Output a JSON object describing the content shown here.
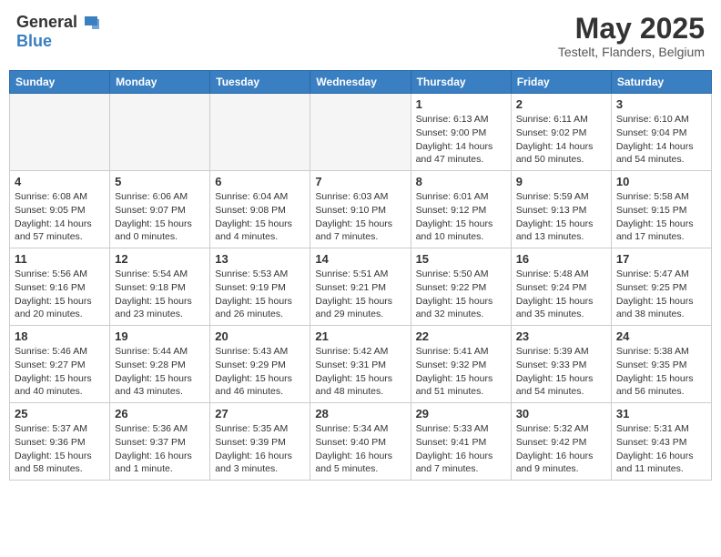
{
  "header": {
    "logo_general": "General",
    "logo_blue": "Blue",
    "title": "May 2025",
    "location": "Testelt, Flanders, Belgium"
  },
  "weekdays": [
    "Sunday",
    "Monday",
    "Tuesday",
    "Wednesday",
    "Thursday",
    "Friday",
    "Saturday"
  ],
  "weeks": [
    [
      {
        "day": "",
        "info": ""
      },
      {
        "day": "",
        "info": ""
      },
      {
        "day": "",
        "info": ""
      },
      {
        "day": "",
        "info": ""
      },
      {
        "day": "1",
        "info": "Sunrise: 6:13 AM\nSunset: 9:00 PM\nDaylight: 14 hours\nand 47 minutes."
      },
      {
        "day": "2",
        "info": "Sunrise: 6:11 AM\nSunset: 9:02 PM\nDaylight: 14 hours\nand 50 minutes."
      },
      {
        "day": "3",
        "info": "Sunrise: 6:10 AM\nSunset: 9:04 PM\nDaylight: 14 hours\nand 54 minutes."
      }
    ],
    [
      {
        "day": "4",
        "info": "Sunrise: 6:08 AM\nSunset: 9:05 PM\nDaylight: 14 hours\nand 57 minutes."
      },
      {
        "day": "5",
        "info": "Sunrise: 6:06 AM\nSunset: 9:07 PM\nDaylight: 15 hours\nand 0 minutes."
      },
      {
        "day": "6",
        "info": "Sunrise: 6:04 AM\nSunset: 9:08 PM\nDaylight: 15 hours\nand 4 minutes."
      },
      {
        "day": "7",
        "info": "Sunrise: 6:03 AM\nSunset: 9:10 PM\nDaylight: 15 hours\nand 7 minutes."
      },
      {
        "day": "8",
        "info": "Sunrise: 6:01 AM\nSunset: 9:12 PM\nDaylight: 15 hours\nand 10 minutes."
      },
      {
        "day": "9",
        "info": "Sunrise: 5:59 AM\nSunset: 9:13 PM\nDaylight: 15 hours\nand 13 minutes."
      },
      {
        "day": "10",
        "info": "Sunrise: 5:58 AM\nSunset: 9:15 PM\nDaylight: 15 hours\nand 17 minutes."
      }
    ],
    [
      {
        "day": "11",
        "info": "Sunrise: 5:56 AM\nSunset: 9:16 PM\nDaylight: 15 hours\nand 20 minutes."
      },
      {
        "day": "12",
        "info": "Sunrise: 5:54 AM\nSunset: 9:18 PM\nDaylight: 15 hours\nand 23 minutes."
      },
      {
        "day": "13",
        "info": "Sunrise: 5:53 AM\nSunset: 9:19 PM\nDaylight: 15 hours\nand 26 minutes."
      },
      {
        "day": "14",
        "info": "Sunrise: 5:51 AM\nSunset: 9:21 PM\nDaylight: 15 hours\nand 29 minutes."
      },
      {
        "day": "15",
        "info": "Sunrise: 5:50 AM\nSunset: 9:22 PM\nDaylight: 15 hours\nand 32 minutes."
      },
      {
        "day": "16",
        "info": "Sunrise: 5:48 AM\nSunset: 9:24 PM\nDaylight: 15 hours\nand 35 minutes."
      },
      {
        "day": "17",
        "info": "Sunrise: 5:47 AM\nSunset: 9:25 PM\nDaylight: 15 hours\nand 38 minutes."
      }
    ],
    [
      {
        "day": "18",
        "info": "Sunrise: 5:46 AM\nSunset: 9:27 PM\nDaylight: 15 hours\nand 40 minutes."
      },
      {
        "day": "19",
        "info": "Sunrise: 5:44 AM\nSunset: 9:28 PM\nDaylight: 15 hours\nand 43 minutes."
      },
      {
        "day": "20",
        "info": "Sunrise: 5:43 AM\nSunset: 9:29 PM\nDaylight: 15 hours\nand 46 minutes."
      },
      {
        "day": "21",
        "info": "Sunrise: 5:42 AM\nSunset: 9:31 PM\nDaylight: 15 hours\nand 48 minutes."
      },
      {
        "day": "22",
        "info": "Sunrise: 5:41 AM\nSunset: 9:32 PM\nDaylight: 15 hours\nand 51 minutes."
      },
      {
        "day": "23",
        "info": "Sunrise: 5:39 AM\nSunset: 9:33 PM\nDaylight: 15 hours\nand 54 minutes."
      },
      {
        "day": "24",
        "info": "Sunrise: 5:38 AM\nSunset: 9:35 PM\nDaylight: 15 hours\nand 56 minutes."
      }
    ],
    [
      {
        "day": "25",
        "info": "Sunrise: 5:37 AM\nSunset: 9:36 PM\nDaylight: 15 hours\nand 58 minutes."
      },
      {
        "day": "26",
        "info": "Sunrise: 5:36 AM\nSunset: 9:37 PM\nDaylight: 16 hours\nand 1 minute."
      },
      {
        "day": "27",
        "info": "Sunrise: 5:35 AM\nSunset: 9:39 PM\nDaylight: 16 hours\nand 3 minutes."
      },
      {
        "day": "28",
        "info": "Sunrise: 5:34 AM\nSunset: 9:40 PM\nDaylight: 16 hours\nand 5 minutes."
      },
      {
        "day": "29",
        "info": "Sunrise: 5:33 AM\nSunset: 9:41 PM\nDaylight: 16 hours\nand 7 minutes."
      },
      {
        "day": "30",
        "info": "Sunrise: 5:32 AM\nSunset: 9:42 PM\nDaylight: 16 hours\nand 9 minutes."
      },
      {
        "day": "31",
        "info": "Sunrise: 5:31 AM\nSunset: 9:43 PM\nDaylight: 16 hours\nand 11 minutes."
      }
    ]
  ]
}
